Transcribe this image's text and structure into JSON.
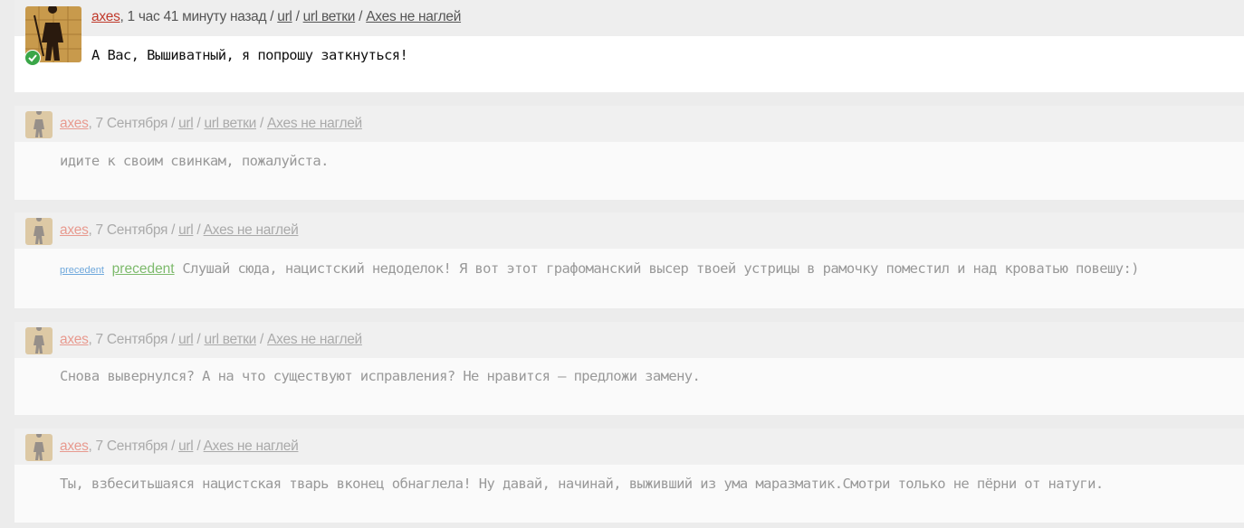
{
  "comments": [
    {
      "author": "axes",
      "time": ", 1 час 41 минуту назад / ",
      "links": [
        "url",
        "url ветки",
        "Axes не наглей"
      ],
      "text": "А Вас, Вышиватный, я попрошу заткнуться!"
    },
    {
      "author": "axes",
      "time": ", 7 Сентября / ",
      "links": [
        "url",
        "url ветки",
        "Axes не наглей"
      ],
      "text": "идите к своим свинкам, пожалуйста."
    },
    {
      "author": "axes",
      "time": ", 7 Сентября / ",
      "links": [
        "url",
        "Axes не наглей"
      ],
      "precedent_small": "precedent",
      "precedent_big": "precedent",
      "text": "Слушай сюда, нацистский недоделок! Я вот этот графоманский высер твоей устрицы в рамочку поместил и над кроватью повешу:)"
    },
    {
      "author": "axes",
      "time": ", 7 Сентября / ",
      "links": [
        "url",
        "url ветки",
        "Axes не наглей"
      ],
      "text": "Снова вывернулся? А на что существуют исправления? Не нравится — предложи замену."
    },
    {
      "author": "axes",
      "time": ", 7 Сентября / ",
      "links": [
        "url",
        "Axes не наглей"
      ],
      "text": "Ты, взбеситьшаяся нацистская тварь вконец обнаглела! Ну давай, начинай, выживший из ума маразматик.Смотри только не пёрни от натуги."
    }
  ],
  "separator": " / "
}
